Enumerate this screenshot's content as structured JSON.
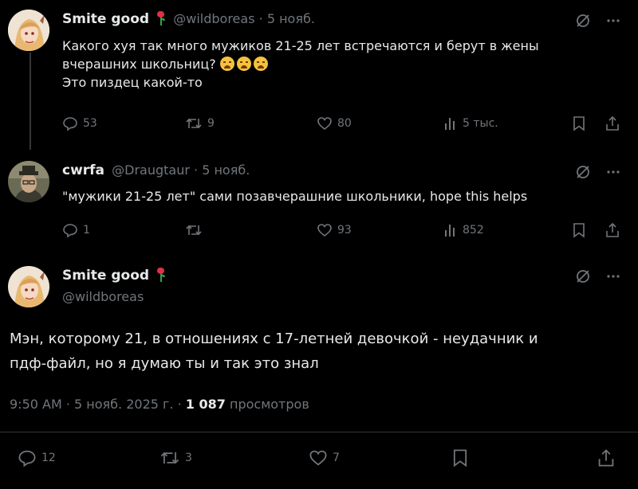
{
  "tweet1": {
    "author": "Smite good",
    "handle": "@wildboreas",
    "date": "5 нояб.",
    "text_line1": "Какого хуя так много мужиков 21-25 лет встречаются и берут в жены",
    "text_line2": "вчерашних школьниц?",
    "text_line3": "Это пиздец какой-то",
    "replies": "53",
    "reposts": "9",
    "likes": "80",
    "views": "5 тыс."
  },
  "tweet2": {
    "author": "cwrfa",
    "handle": "@Draugtaur",
    "date": "5 нояб.",
    "text": "\"мужики 21-25 лет\" сами позавчерашние школьники, hope this helps",
    "replies": "1",
    "reposts": "",
    "likes": "93",
    "views": "852"
  },
  "tweet3": {
    "author": "Smite good",
    "handle": "@wildboreas",
    "text_line1": "Мэн, которому 21, в отношениях с 17-летней девочкой - неудачник и",
    "text_line2": "пдф-файл, но я думаю ты и так это знал",
    "time": "9:50 AM",
    "full_date": "5 нояб. 2025 г.",
    "views_count": "1 087",
    "views_label": "просмотров",
    "replies": "12",
    "reposts": "3",
    "likes": "7"
  },
  "separator": " · ",
  "icons": {
    "more": "more-icon",
    "grok": "grok-icon",
    "reply": "reply-icon",
    "repost": "repost-icon",
    "like": "heart-icon",
    "views": "views-icon",
    "bookmark": "bookmark-icon",
    "share": "share-icon"
  }
}
